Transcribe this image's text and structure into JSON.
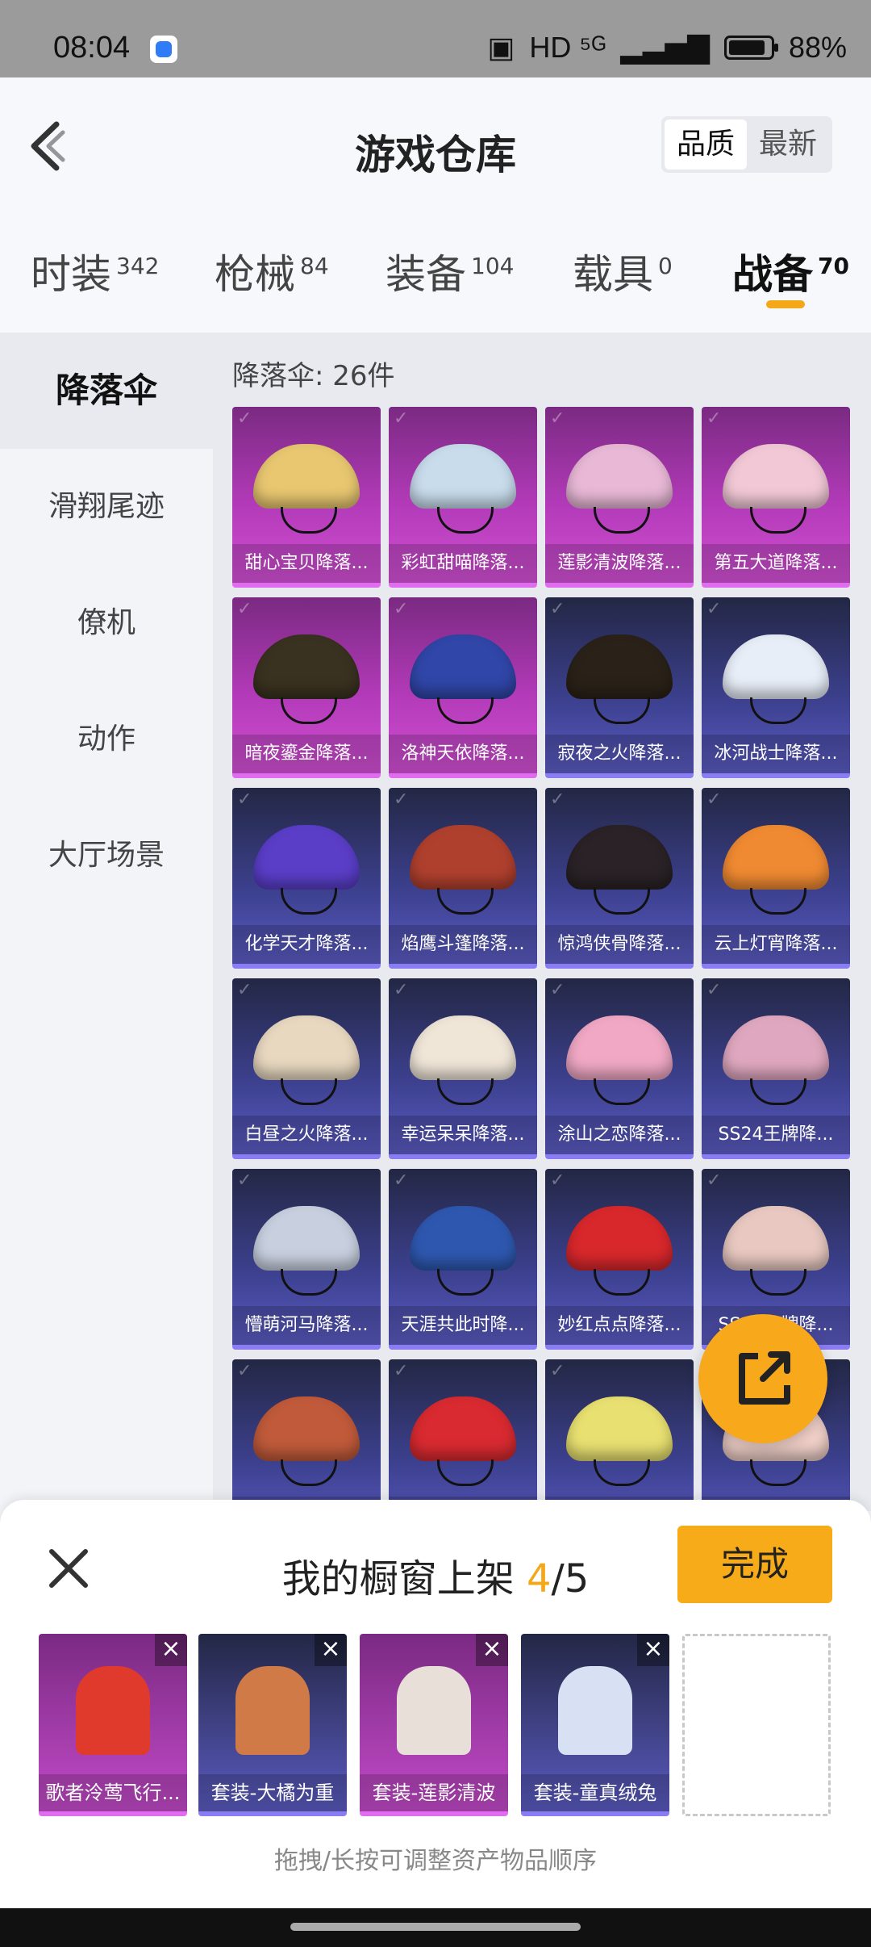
{
  "status_bar": {
    "time": "08:04",
    "signal_text": "HD ⁵ᴳ",
    "battery_percent": "88%"
  },
  "header": {
    "title": "游戏仓库",
    "sort": [
      "品质",
      "最新"
    ],
    "active_sort": "品质"
  },
  "tabs": [
    {
      "label": "时装",
      "count": "342"
    },
    {
      "label": "枪械",
      "count": "84"
    },
    {
      "label": "装备",
      "count": "104"
    },
    {
      "label": "载具",
      "count": "0"
    },
    {
      "label": "战备",
      "count": "70",
      "active": true
    }
  ],
  "sidebar": [
    {
      "label": "降落伞",
      "active": true
    },
    {
      "label": "滑翔尾迹"
    },
    {
      "label": "僚机"
    },
    {
      "label": "动作"
    },
    {
      "label": "大厅场景"
    }
  ],
  "grid": {
    "count_text": "降落伞: 26件",
    "items": [
      {
        "label": "甜心宝贝降落...",
        "rarity": "purple",
        "color": "#e8c770"
      },
      {
        "label": "彩虹甜喵降落...",
        "rarity": "purple",
        "color": "#c8dcec"
      },
      {
        "label": "莲影清波降落...",
        "rarity": "purple",
        "color": "#e8b8d6"
      },
      {
        "label": "第五大道降落...",
        "rarity": "purple",
        "color": "#f2c8d6"
      },
      {
        "label": "暗夜鎏金降落...",
        "rarity": "purple",
        "color": "#3a3220"
      },
      {
        "label": "洛神天依降落...",
        "rarity": "purple",
        "color": "#3046a8"
      },
      {
        "label": "寂夜之火降落...",
        "rarity": "blue",
        "color": "#2a2218"
      },
      {
        "label": "冰河战士降落...",
        "rarity": "blue",
        "color": "#e8eef8"
      },
      {
        "label": "化学天才降落...",
        "rarity": "blue",
        "color": "#5a3ec8"
      },
      {
        "label": "焰鹰斗篷降落...",
        "rarity": "blue",
        "color": "#b0402e"
      },
      {
        "label": "惊鸿侠骨降落...",
        "rarity": "blue",
        "color": "#2a2226"
      },
      {
        "label": "云上灯宵降落...",
        "rarity": "blue",
        "color": "#f08a32"
      },
      {
        "label": "白昼之火降落...",
        "rarity": "blue",
        "color": "#e8d8c0"
      },
      {
        "label": "幸运呆呆降落...",
        "rarity": "blue",
        "color": "#f0e6d8"
      },
      {
        "label": "涂山之恋降落...",
        "rarity": "blue",
        "color": "#f0a8c4"
      },
      {
        "label": "SS24王牌降...",
        "rarity": "blue",
        "color": "#e0a8c0"
      },
      {
        "label": "懵萌河马降落...",
        "rarity": "blue",
        "color": "#c8d0e0"
      },
      {
        "label": "天涯共此时降...",
        "rarity": "blue",
        "color": "#2e58b0"
      },
      {
        "label": "妙红点点降落...",
        "rarity": "blue",
        "color": "#d8282c"
      },
      {
        "label": "SS23王牌降...",
        "rarity": "blue",
        "color": "#e8c8c0"
      },
      {
        "label": "",
        "rarity": "blue",
        "color": "#c05a3a"
      },
      {
        "label": "",
        "rarity": "blue",
        "color": "#d82a30"
      },
      {
        "label": "",
        "rarity": "blue",
        "color": "#e8e070"
      },
      {
        "label": "",
        "rarity": "blue",
        "color": "#f0d0c8"
      }
    ]
  },
  "showcase": {
    "title_prefix": "我的橱窗上架 ",
    "current": "4",
    "total": "/5",
    "done_label": "完成",
    "hint": "拖拽/长按可调整资产物品顺序",
    "slots": [
      {
        "label": "歌者泠莺飞行...",
        "rarity": "purple",
        "color": "#e03a2c"
      },
      {
        "label": "套装-大橘为重",
        "rarity": "blue",
        "color": "#d07a48"
      },
      {
        "label": "套装-莲影清波",
        "rarity": "purple",
        "color": "#e8e0d8"
      },
      {
        "label": "套装-童真绒兔",
        "rarity": "blue",
        "color": "#d8e0f4"
      }
    ]
  }
}
